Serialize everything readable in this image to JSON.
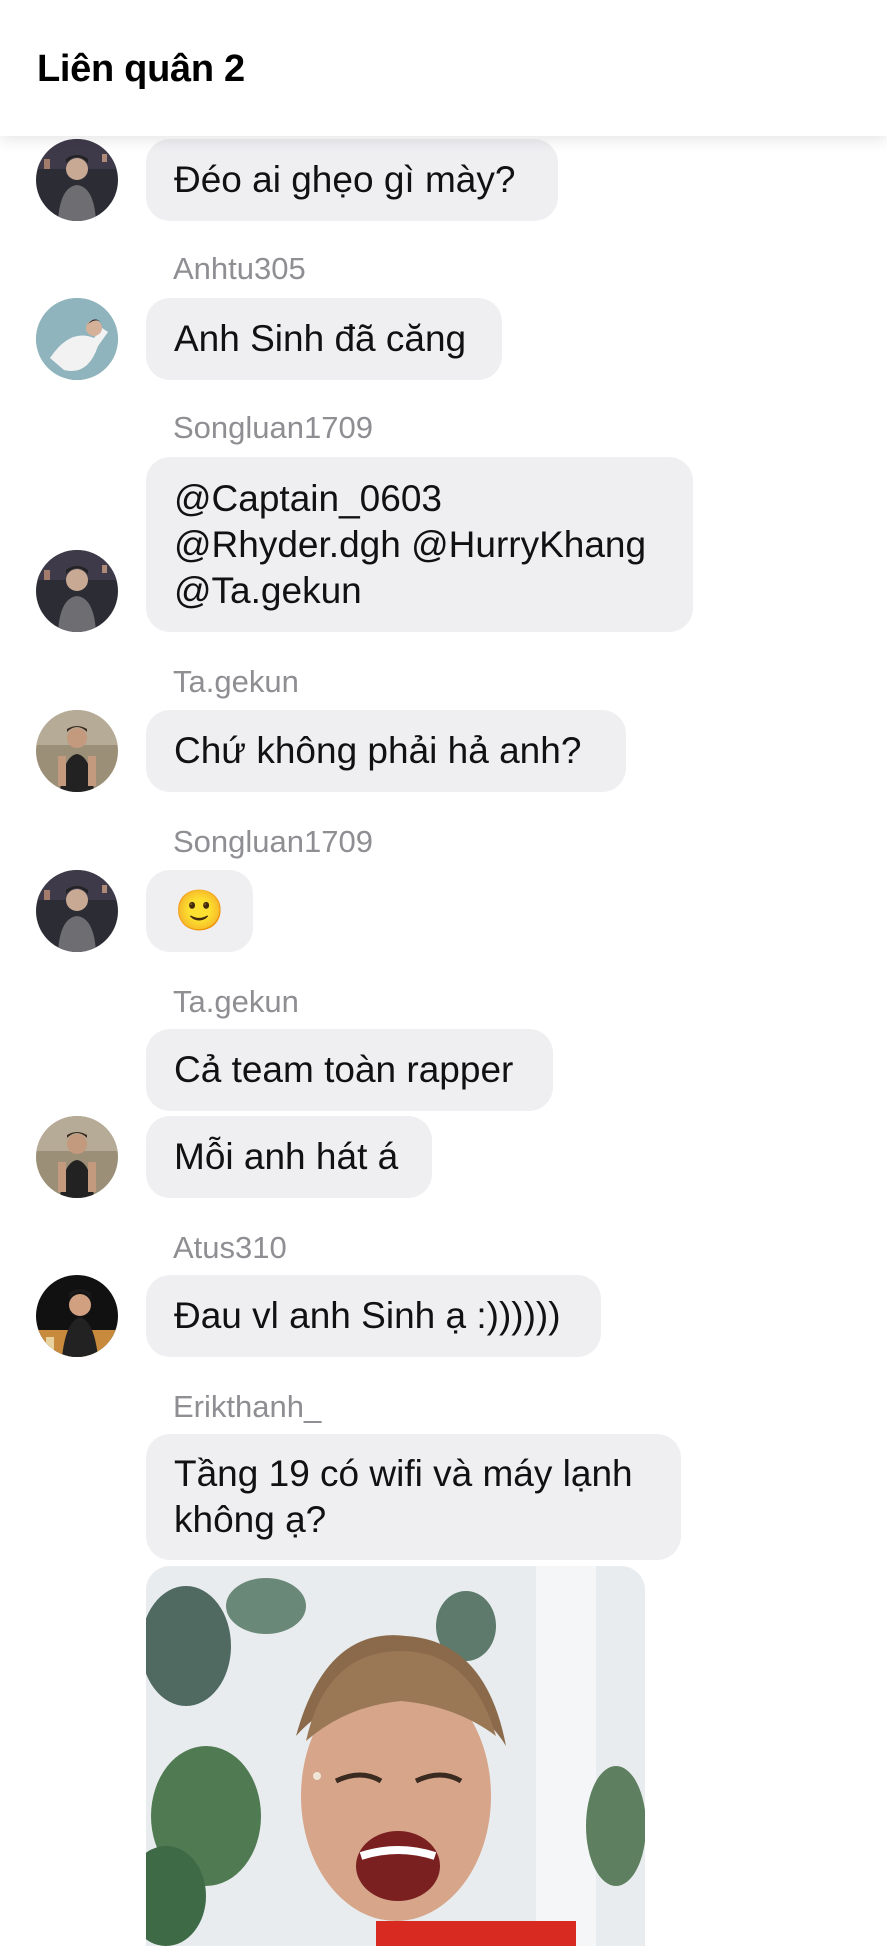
{
  "header": {
    "title": "Liên quân 2"
  },
  "messages": [
    {
      "text": "Đéo ai ghẹo gì mày?"
    },
    {
      "sender": "Anhtu305",
      "text": "Anh Sinh đã căng"
    },
    {
      "sender": "Songluan1709",
      "text": "@Captain_0603\n@Rhyder.dgh @HurryKhang\n@Ta.gekun"
    },
    {
      "sender": "Ta.gekun",
      "text": "Chứ không phải hả anh?"
    },
    {
      "sender": "Songluan1709",
      "text": "🙂"
    },
    {
      "sender": "Ta.gekun",
      "text": "Cả team toàn rapper"
    },
    {
      "text": "Mỗi anh hát á"
    },
    {
      "sender": "Atus310",
      "text": "Đau vl anh Sinh ạ :))))))"
    },
    {
      "sender": "Erikthanh_",
      "text": "Tầng 19 có wifi và máy lạnh\nkhông ạ?"
    }
  ]
}
